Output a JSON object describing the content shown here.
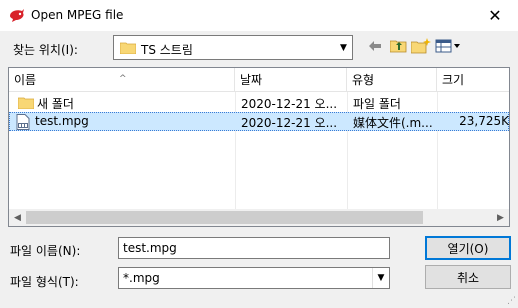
{
  "window": {
    "title": "Open MPEG file",
    "close_glyph": "✕"
  },
  "look_in": {
    "label": "찾는 위치(I):",
    "value": "TS 스트림"
  },
  "toolbar": [
    "back-arrow-icon",
    "up-folder-icon",
    "new-folder-icon",
    "view-menu-icon"
  ],
  "columns": {
    "name": "이름",
    "date": "날짜",
    "type": "유형",
    "size": "크기"
  },
  "files": [
    {
      "name": "새 폴더",
      "date": "2020-12-21 오...",
      "type": "파일 폴더",
      "size": "",
      "icon": "folder-icon"
    },
    {
      "name": "test.mpg",
      "date": "2020-12-21 오...",
      "type": "媒体文件(.m...",
      "size": "23,725K",
      "icon": "video-file-icon",
      "selected": true
    }
  ],
  "filename": {
    "label": "파일 이름(N):",
    "value": "test.mpg"
  },
  "filetype": {
    "label": "파일 형식(T):",
    "value": "*.mpg"
  },
  "buttons": {
    "open": "열기(O)",
    "cancel": "취소"
  },
  "colors": {
    "selection": "#cce8ff",
    "accent": "#0078d7",
    "folder": "#f8d775"
  }
}
